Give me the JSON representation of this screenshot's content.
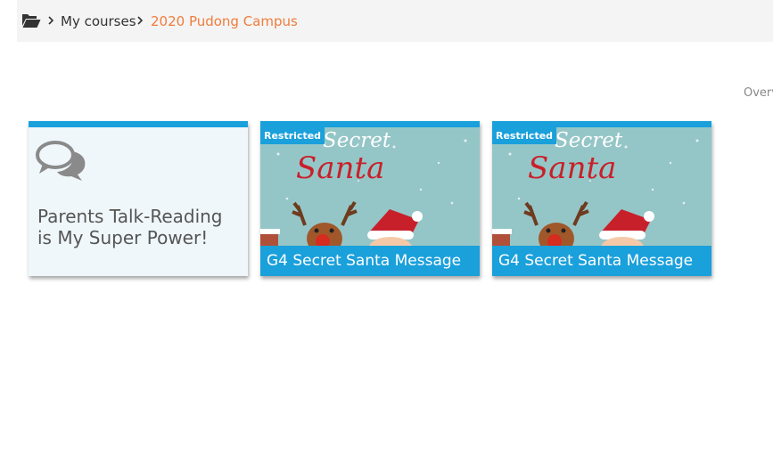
{
  "breadcrumb": {
    "folder_icon": "folder-open-icon",
    "separator_icon": "chevron-right-icon",
    "items": [
      "My courses",
      "2020 Pudong Campus"
    ],
    "current_color": "#ef7d3c"
  },
  "overview_label": "Overvi",
  "cards": [
    {
      "title": "Parents Talk-Reading is My Super Power!",
      "icon": "forum-chat-icon",
      "accent": "#1aa0db"
    },
    {
      "title": "G4 Secret Santa Message",
      "badge": "Restricted",
      "image_label_1": "Secret",
      "image_label_2": "Santa"
    },
    {
      "title": "G4 Secret Santa Message",
      "badge": "Restricted",
      "image_label_1": "Secret",
      "image_label_2": "Santa"
    }
  ]
}
